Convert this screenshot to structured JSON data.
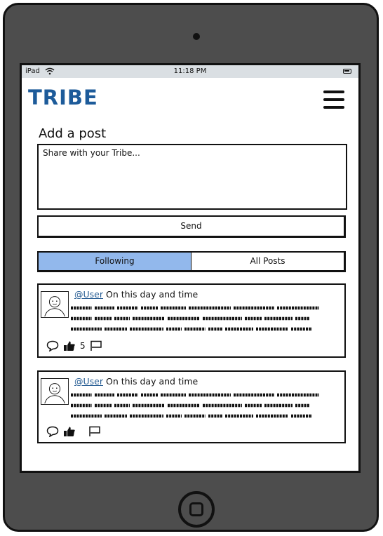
{
  "status_bar": {
    "device": "iPad",
    "time": "11:18 PM"
  },
  "app": {
    "logo": "TRIBE"
  },
  "add_post": {
    "title": "Add a post",
    "placeholder": "Share with your Tribe...",
    "send_label": "Send"
  },
  "feed_tabs": [
    {
      "label": "Following",
      "active": true
    },
    {
      "label": "All Posts",
      "active": false
    }
  ],
  "posts": [
    {
      "user": "@User",
      "meta": "On this day and time",
      "like_count": "5"
    },
    {
      "user": "@User",
      "meta": "On this day and time",
      "like_count": ""
    }
  ],
  "icons": [
    "wifi-icon",
    "battery-icon",
    "menu-icon",
    "avatar",
    "comment-icon",
    "like-icon",
    "flag-icon",
    "home-button"
  ],
  "colors": {
    "logo": "#1d5b9a",
    "active_tab": "#92b8ec",
    "device_frame": "#4d4d4d",
    "status_bar": "#dadfe3"
  }
}
